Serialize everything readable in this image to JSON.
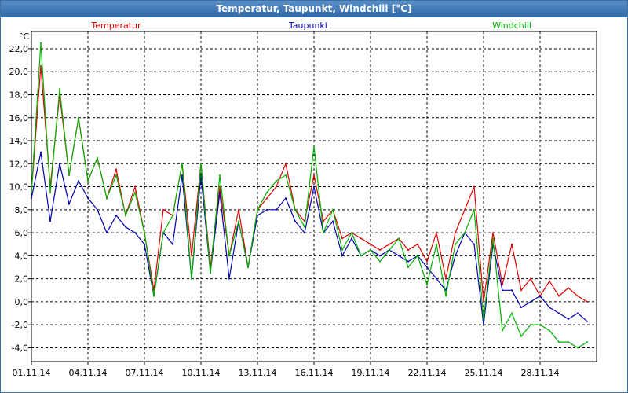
{
  "window": {
    "title": "Temperatur, Taupunkt, Windchill [°C]"
  },
  "chart_data": {
    "type": "line",
    "title": "Temperatur, Taupunkt, Windchill [°C]",
    "ylabel": "°C",
    "xlabel": "",
    "x_ticks": [
      "01.11.14",
      "04.11.14",
      "07.11.14",
      "10.11.14",
      "13.11.14",
      "16.11.14",
      "19.11.14",
      "22.11.14",
      "25.11.14",
      "28.11.14"
    ],
    "x_range": [
      "01.11.14",
      "01.12.14"
    ],
    "y_ticks": [
      "-4,0",
      "-2,0",
      "0,0",
      "2,0",
      "4,0",
      "6,0",
      "8,0",
      "10,0",
      "12,0",
      "14,0",
      "16,0",
      "18,0",
      "20,0",
      "22,0"
    ],
    "ylim": [
      -5.2,
      23.5
    ],
    "grid": true,
    "legend": "top",
    "x": [
      "01.11.14",
      "01.11.14 12h",
      "02.11.14",
      "02.11.14 12h",
      "03.11.14",
      "03.11.14 12h",
      "04.11.14",
      "04.11.14 12h",
      "05.11.14",
      "05.11.14 12h",
      "06.11.14",
      "06.11.14 12h",
      "07.11.14",
      "07.11.14 12h",
      "08.11.14",
      "08.11.14 12h",
      "09.11.14",
      "09.11.14 12h",
      "10.11.14",
      "10.11.14 12h",
      "11.11.14",
      "11.11.14 12h",
      "12.11.14",
      "12.11.14 12h",
      "13.11.14",
      "13.11.14 12h",
      "14.11.14",
      "14.11.14 12h",
      "15.11.14",
      "15.11.14 12h",
      "16.11.14",
      "16.11.14 12h",
      "17.11.14",
      "17.11.14 12h",
      "18.11.14",
      "18.11.14 12h",
      "19.11.14",
      "19.11.14 12h",
      "20.11.14",
      "20.11.14 12h",
      "21.11.14",
      "21.11.14 12h",
      "22.11.14",
      "22.11.14 12h",
      "23.11.14",
      "23.11.14 12h",
      "24.11.14",
      "24.11.14 12h",
      "25.11.14",
      "25.11.14 12h",
      "26.11.14",
      "26.11.14 12h",
      "27.11.14",
      "27.11.14 12h",
      "28.11.14",
      "28.11.14 12h",
      "29.11.14",
      "29.11.14 12h",
      "30.11.14",
      "30.11.14 12h"
    ],
    "series": [
      {
        "name": "Temperatur",
        "color": "#e00000",
        "values": [
          9.5,
          20.5,
          10,
          18,
          11,
          16,
          10.5,
          12.5,
          9,
          11.5,
          7.5,
          10,
          6,
          1,
          8,
          7.5,
          12,
          4,
          12,
          3,
          10,
          4,
          8,
          3,
          8,
          9,
          10,
          12,
          8,
          7,
          11,
          7,
          8,
          5.5,
          6,
          5.5,
          5,
          4.5,
          5,
          5.5,
          4.5,
          5,
          3.5,
          6,
          2,
          6,
          8,
          10,
          0,
          6,
          1.5,
          5,
          1,
          2,
          0.5,
          1.8,
          0.5,
          1.2,
          0.5,
          0
        ]
      },
      {
        "name": "Taupunkt",
        "color": "#0000b0",
        "values": [
          9,
          13,
          7,
          12,
          8.5,
          10.5,
          9,
          8,
          6,
          7.5,
          6.5,
          6,
          5,
          0.5,
          6,
          5,
          11,
          2,
          11,
          2.5,
          9.5,
          2,
          7,
          3,
          7.5,
          8,
          8,
          9,
          7,
          6,
          10,
          6,
          7,
          4,
          5.5,
          4,
          4.5,
          4,
          4.5,
          4,
          3.5,
          4,
          3,
          2,
          1,
          4,
          6,
          5,
          -2,
          5,
          1,
          1,
          -0.5,
          0,
          0.5,
          -0.5,
          -1,
          -1.5,
          -1,
          -1.7
        ]
      },
      {
        "name": "Windchill",
        "color": "#00b000",
        "values": [
          9.5,
          22.5,
          9.5,
          18.5,
          11,
          16,
          10.5,
          12.5,
          9,
          11,
          7.5,
          9.5,
          6,
          0.5,
          6,
          7.5,
          12,
          2,
          12,
          2.5,
          11,
          4,
          7,
          3,
          8,
          9.5,
          10.5,
          11,
          8,
          6.5,
          13.5,
          6,
          8,
          4.5,
          6,
          4,
          4.5,
          3.5,
          4.5,
          5.5,
          3,
          4,
          1.5,
          5,
          0.5,
          5,
          6,
          8,
          -1.5,
          5.5,
          -2.5,
          -1,
          -3,
          -2,
          -2,
          -2.5,
          -3.5,
          -3.5,
          -4,
          -3.5
        ]
      }
    ]
  }
}
